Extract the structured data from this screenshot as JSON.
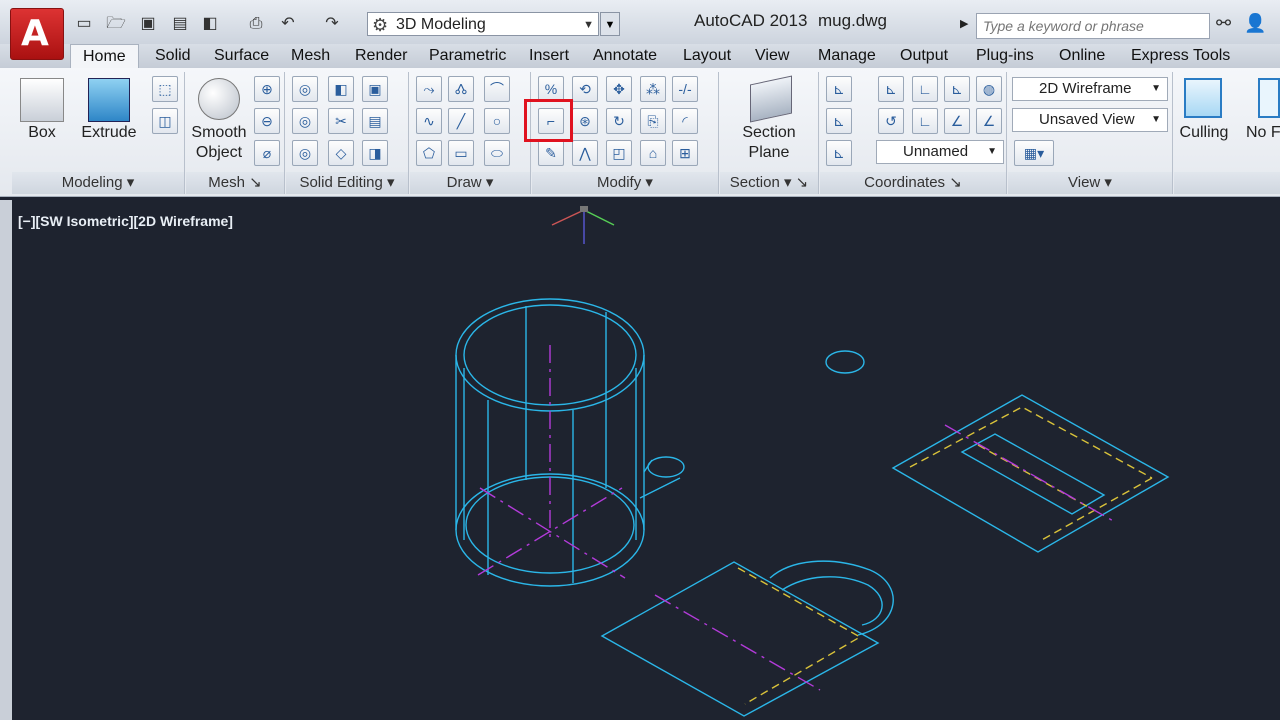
{
  "titlebar": {
    "app_letter": "A",
    "workspace": "3D Modeling",
    "app_title": "AutoCAD 2013",
    "doc_title": "mug.dwg",
    "search_placeholder": "Type a keyword or phrase"
  },
  "tabs": [
    "Home",
    "Solid",
    "Surface",
    "Mesh",
    "Render",
    "Parametric",
    "Insert",
    "Annotate",
    "Layout",
    "View",
    "Manage",
    "Output",
    "Plug-ins",
    "Online",
    "Express Tools"
  ],
  "ribbon": {
    "box": "Box",
    "extrude": "Extrude",
    "smooth_1": "Smooth",
    "smooth_2": "Object",
    "section_1": "Section",
    "section_2": "Plane",
    "visual_style": "2D Wireframe",
    "view_state": "Unsaved View",
    "ucs_name": "Unnamed",
    "culling": "Culling",
    "no_filter": "No F",
    "panels": {
      "modeling": "Modeling",
      "mesh": "Mesh",
      "solid_editing": "Solid Editing",
      "draw": "Draw",
      "modify": "Modify",
      "section": "Section",
      "coordinates": "Coordinates",
      "view": "View"
    }
  },
  "viewport": {
    "label": "[−][SW Isometric][2D Wireframe]"
  },
  "colors": {
    "wire": "#2bb6e8",
    "axis": "#b23bd9",
    "dashed": "#d9c23a",
    "background": "#1e232f",
    "highlight": "#e0121f"
  }
}
